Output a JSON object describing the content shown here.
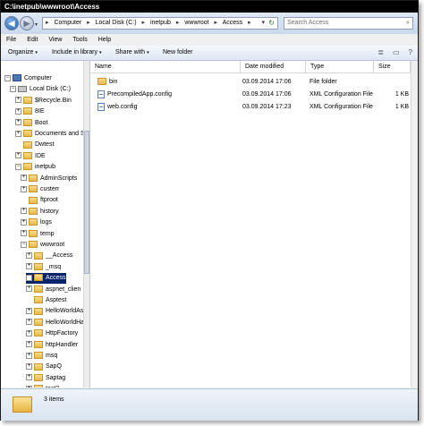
{
  "window": {
    "title": "C:\\inetpub\\wwwroot\\Access"
  },
  "address": {
    "crumbs": [
      "Computer",
      "Local Disk (C:)",
      "inetpub",
      "wwwroot",
      "Access"
    ],
    "separator": "▸"
  },
  "search": {
    "placeholder": "Search Access"
  },
  "menu": [
    "File",
    "Edit",
    "View",
    "Tools",
    "Help"
  ],
  "toolbar": {
    "organize": "Organize",
    "include": "Include in library",
    "share": "Share with",
    "newfolder": "New folder"
  },
  "tree": [
    {
      "label": "Computer",
      "indent": 0,
      "expander": "−",
      "icon": "computer"
    },
    {
      "label": "Local Disk (C:)",
      "indent": 1,
      "expander": "−",
      "icon": "disk"
    },
    {
      "label": "$Recycle.Bin",
      "indent": 2,
      "expander": "+",
      "icon": "folder"
    },
    {
      "label": "8IE",
      "indent": 2,
      "expander": "+",
      "icon": "folder"
    },
    {
      "label": "Boot",
      "indent": 2,
      "expander": "+",
      "icon": "folder"
    },
    {
      "label": "Documents and S",
      "indent": 2,
      "expander": "+",
      "icon": "folder"
    },
    {
      "label": "Dwtest",
      "indent": 2,
      "expander": "",
      "icon": "folder"
    },
    {
      "label": "IDE",
      "indent": 2,
      "expander": "+",
      "icon": "folder"
    },
    {
      "label": "inetpub",
      "indent": 2,
      "expander": "−",
      "icon": "folder"
    },
    {
      "label": "AdminScripts",
      "indent": 3,
      "expander": "+",
      "icon": "folder"
    },
    {
      "label": "custerr",
      "indent": 3,
      "expander": "+",
      "icon": "folder"
    },
    {
      "label": "ftproot",
      "indent": 3,
      "expander": "",
      "icon": "folder"
    },
    {
      "label": "history",
      "indent": 3,
      "expander": "+",
      "icon": "folder"
    },
    {
      "label": "logs",
      "indent": 3,
      "expander": "+",
      "icon": "folder"
    },
    {
      "label": "temp",
      "indent": 3,
      "expander": "+",
      "icon": "folder"
    },
    {
      "label": "wwwroot",
      "indent": 3,
      "expander": "−",
      "icon": "folder"
    },
    {
      "label": "__Access",
      "indent": 4,
      "expander": "+",
      "icon": "folder"
    },
    {
      "label": "_msq",
      "indent": 4,
      "expander": "+",
      "icon": "folder"
    },
    {
      "label": "Access",
      "indent": 4,
      "expander": "+",
      "icon": "folder",
      "selected": true
    },
    {
      "label": "aspnet_clien",
      "indent": 4,
      "expander": "+",
      "icon": "folder"
    },
    {
      "label": "Asptest",
      "indent": 4,
      "expander": "",
      "icon": "folder"
    },
    {
      "label": "HelloWorldAs",
      "indent": 4,
      "expander": "+",
      "icon": "folder"
    },
    {
      "label": "HelloWorldHa",
      "indent": 4,
      "expander": "+",
      "icon": "folder"
    },
    {
      "label": "HttpFactory",
      "indent": 4,
      "expander": "+",
      "icon": "folder"
    },
    {
      "label": "httpHandler",
      "indent": 4,
      "expander": "+",
      "icon": "folder"
    },
    {
      "label": "msq",
      "indent": 4,
      "expander": "+",
      "icon": "folder"
    },
    {
      "label": "SapQ",
      "indent": 4,
      "expander": "+",
      "icon": "folder"
    },
    {
      "label": "Saptag",
      "indent": 4,
      "expander": "+",
      "icon": "folder"
    },
    {
      "label": "test2",
      "indent": 4,
      "expander": "+",
      "icon": "folder"
    }
  ],
  "columns": {
    "name": "Name",
    "date": "Date modified",
    "type": "Type",
    "size": "Size"
  },
  "files": [
    {
      "name": "bin",
      "date": "03.09.2014 17:06",
      "type": "File folder",
      "size": "",
      "icon": "folder"
    },
    {
      "name": "PrecompiledApp.config",
      "date": "03.09.2014 17:06",
      "type": "XML Configuration File",
      "size": "1 KB",
      "icon": "config"
    },
    {
      "name": "web.config",
      "date": "03.09.2014 17:23",
      "type": "XML Configuration File",
      "size": "1 KB",
      "icon": "config"
    }
  ],
  "status": {
    "count": "3 items"
  },
  "icons": {
    "back": "◀",
    "forward": "▶",
    "dropdown": "▾",
    "refresh": "↻",
    "search": "⌕",
    "views": "≣",
    "pane": "▭",
    "help": "?"
  }
}
